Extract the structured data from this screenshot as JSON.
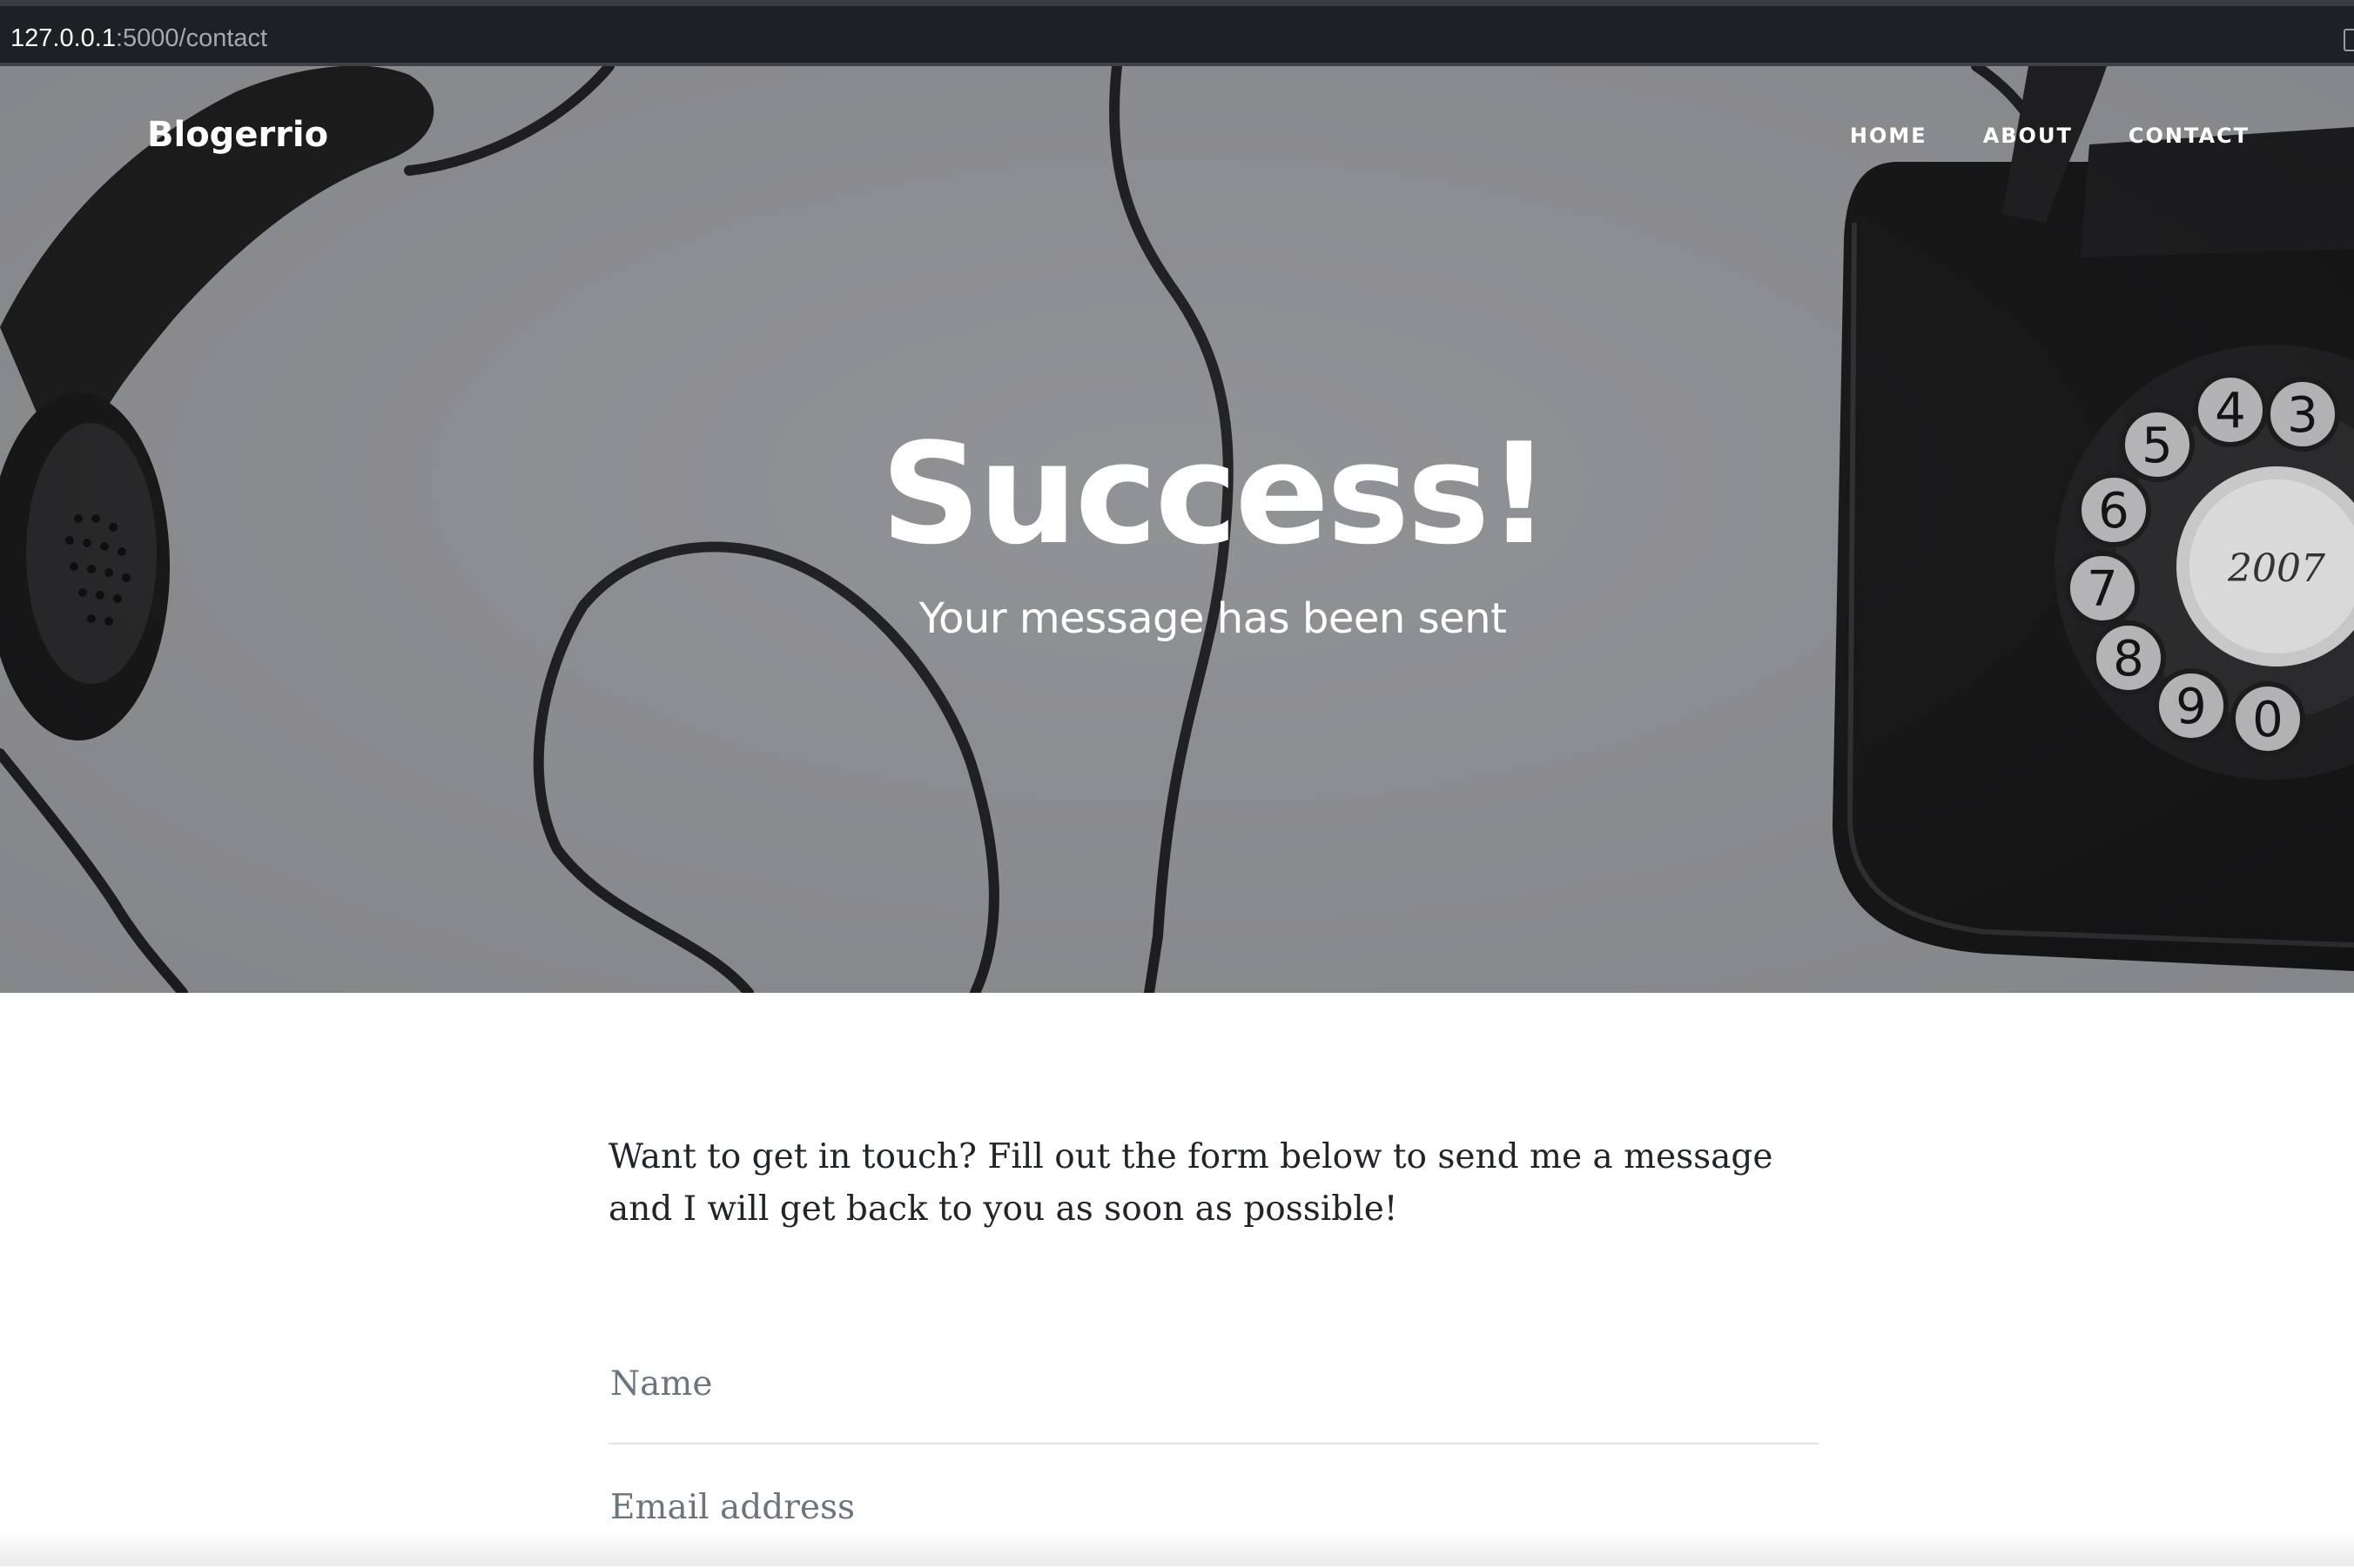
{
  "browser": {
    "url_host": "127.0.0.1",
    "url_path": ":5000/contact"
  },
  "header": {
    "brand": "Blogerrio",
    "nav": [
      {
        "label": "HOME"
      },
      {
        "label": "ABOUT"
      },
      {
        "label": "CONTACT"
      }
    ]
  },
  "hero": {
    "title": "Success!",
    "subtitle": "Your message has been sent"
  },
  "main": {
    "intro": "Want to get in touch? Fill out the form below to send me a message and I will get back to you as soon as possible!",
    "form": {
      "name_placeholder": "Name",
      "email_placeholder": "Email address"
    }
  }
}
